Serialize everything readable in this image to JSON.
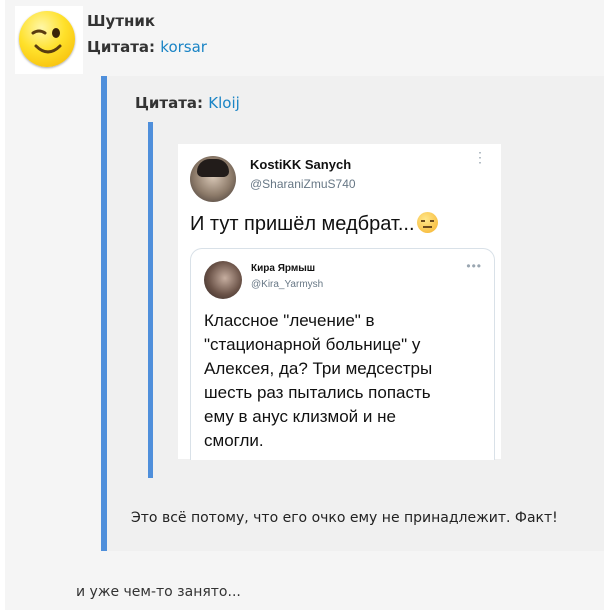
{
  "post": {
    "username": "Шутник",
    "quote_prefix": "Цитата:",
    "quote_author": "korsar",
    "body": "и уже чем-то занято..."
  },
  "quote1": {
    "prefix": "Цитата:",
    "author": "Kloij",
    "reply": "Это всё потому, что его очко ему не принадлежит. Факт!"
  },
  "tweet": {
    "name": "KostiKK Sanych",
    "handle": "@SharaniZmuS740",
    "text": "И тут пришёл медбрат...",
    "emoji": "expressionless-face-icon",
    "more": "⋮"
  },
  "inner_tweet": {
    "name": "Кира Ярмыш",
    "handle": "@Kira_Yarmysh",
    "more": "•••",
    "lines": [
      "Классное \"лечение\" в",
      "\"стационарной больнице\" у",
      "Алексея, да? Три медсестры",
      "шесть раз пытались попасть",
      "ему в анус клизмой и не",
      "смогли."
    ]
  },
  "colors": {
    "quote_bar": "#4f8fdb",
    "link": "#1a84c5",
    "post_bg": "#f5f5f5",
    "twitter_gray": "#677785"
  }
}
